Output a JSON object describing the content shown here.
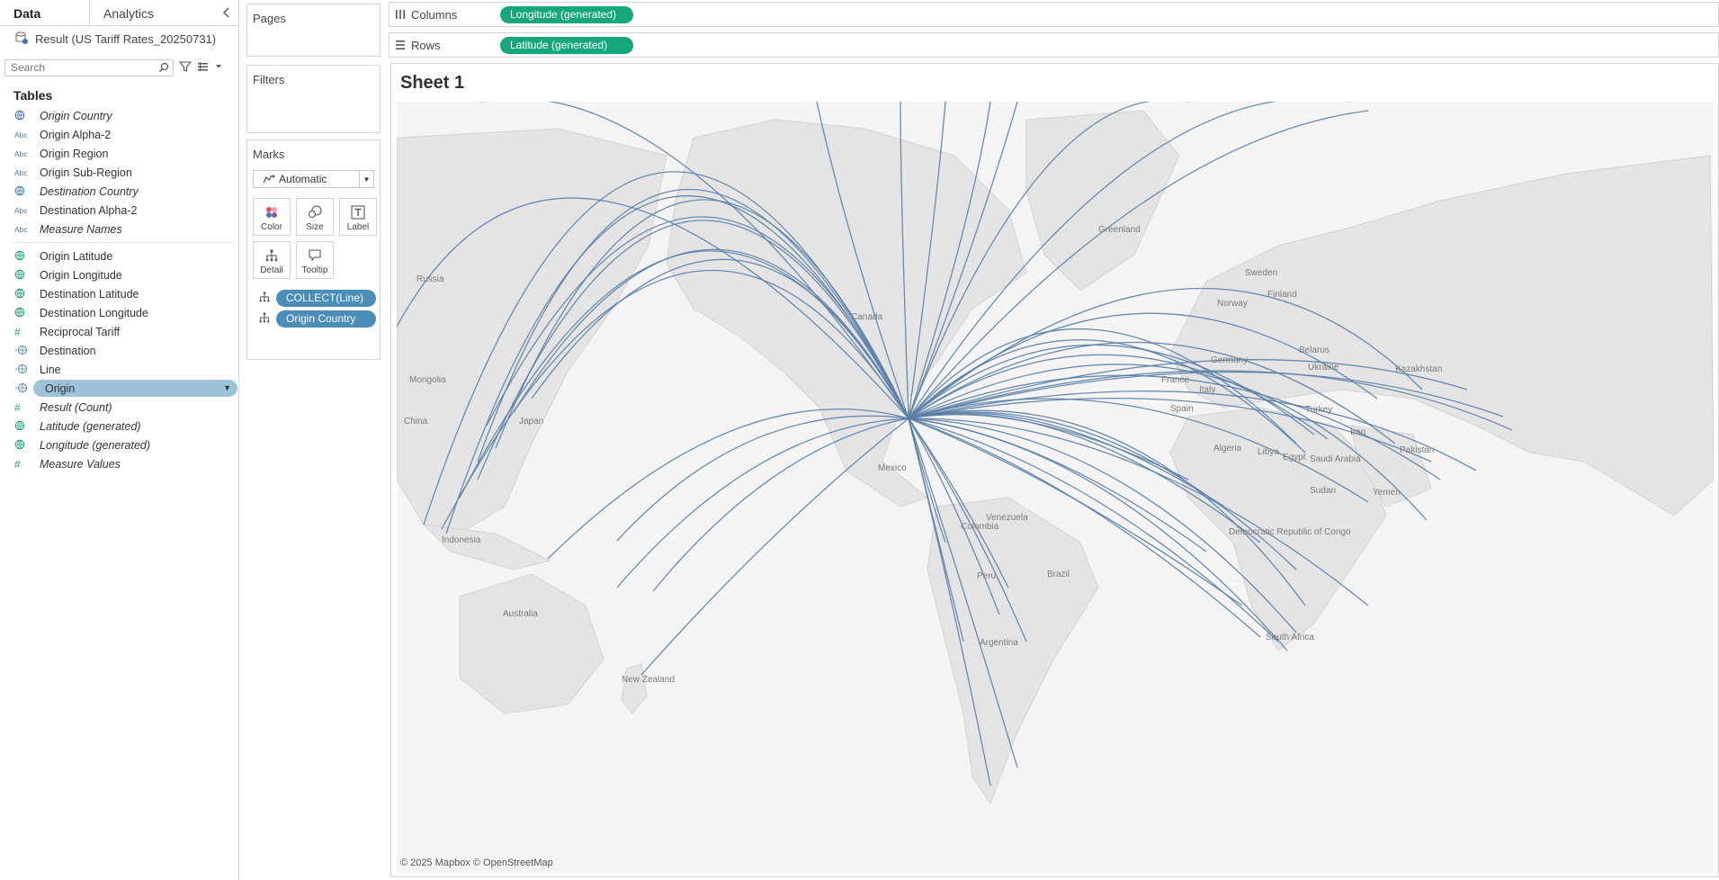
{
  "data_pane": {
    "tabs": [
      {
        "label": "Data",
        "active": true
      },
      {
        "label": "Analytics",
        "active": false
      }
    ],
    "datasource": "Result (US Tariff Rates_20250731)",
    "search_placeholder": "Search",
    "tables_header": "Tables",
    "dimensions": [
      {
        "icon": "globe",
        "label": "Origin Country"
      },
      {
        "icon": "Abc",
        "label": "Origin Alpha-2"
      },
      {
        "icon": "Abc",
        "label": "Origin Region"
      },
      {
        "icon": "Abc",
        "label": "Origin Sub-Region"
      },
      {
        "icon": "globe",
        "label": "Destination Country"
      },
      {
        "icon": "Abc",
        "label": "Destination Alpha-2"
      },
      {
        "icon": "Abc",
        "label": "Measure Names"
      }
    ],
    "measures": [
      {
        "icon": "globe",
        "label": "Origin Latitude"
      },
      {
        "icon": "globe",
        "label": "Origin Longitude"
      },
      {
        "icon": "globe",
        "label": "Destination Latitude"
      },
      {
        "icon": "globe",
        "label": "Destination Longitude"
      },
      {
        "icon": "#",
        "label": "Reciprocal Tariff"
      },
      {
        "icon": "geo",
        "label": "Destination"
      },
      {
        "icon": "geo",
        "label": "Line"
      },
      {
        "icon": "geo",
        "label": "Origin",
        "selected": true
      },
      {
        "icon": "#",
        "label": "Result (Count)"
      },
      {
        "icon": "globe",
        "label": "Latitude (generated)"
      },
      {
        "icon": "globe",
        "label": "Longitude (generated)"
      },
      {
        "icon": "#",
        "label": "Measure Values"
      }
    ]
  },
  "cards": {
    "pages_title": "Pages",
    "filters_title": "Filters",
    "marks_title": "Marks",
    "mark_type": "Automatic",
    "mark_buttons": {
      "color": "Color",
      "size": "Size",
      "label": "Label",
      "detail": "Detail",
      "tooltip": "Tooltip"
    },
    "mark_pills": [
      "COLLECT(Line)",
      "Origin Country"
    ]
  },
  "shelves": {
    "columns_label": "Columns",
    "columns_pill": "Longitude (generated)",
    "rows_label": "Rows",
    "rows_pill": "Latitude (generated)"
  },
  "sheet": {
    "title": "Sheet 1",
    "attribution": "© 2025 Mapbox © OpenStreetMap",
    "map_labels": [
      "Russia",
      "Greenland",
      "Canada",
      "Mongolia",
      "China",
      "Japan",
      "Mexico",
      "Colombia",
      "Venezuela",
      "Peru",
      "Brazil",
      "Argentina",
      "Indonesia",
      "Australia",
      "New Zealand",
      "Norway",
      "Sweden",
      "Finland",
      "Belarus",
      "Ukraine",
      "Germany",
      "France",
      "Italy",
      "Spain",
      "Turkey",
      "Iran",
      "Kazakhstan",
      "Pakistan",
      "Algeria",
      "Libya",
      "Egypt",
      "Saudi Arabia",
      "Sudan",
      "Yemen",
      "Democratic Republic of Congo",
      "South Africa"
    ]
  },
  "colors": {
    "route_line": "#5b7fa6",
    "pill_blue": "#4a8db7",
    "pill_green": "#17a67c",
    "selected_field": "#9cc3d7",
    "land": "#e4e4e4",
    "water": "#f4f4f4"
  }
}
